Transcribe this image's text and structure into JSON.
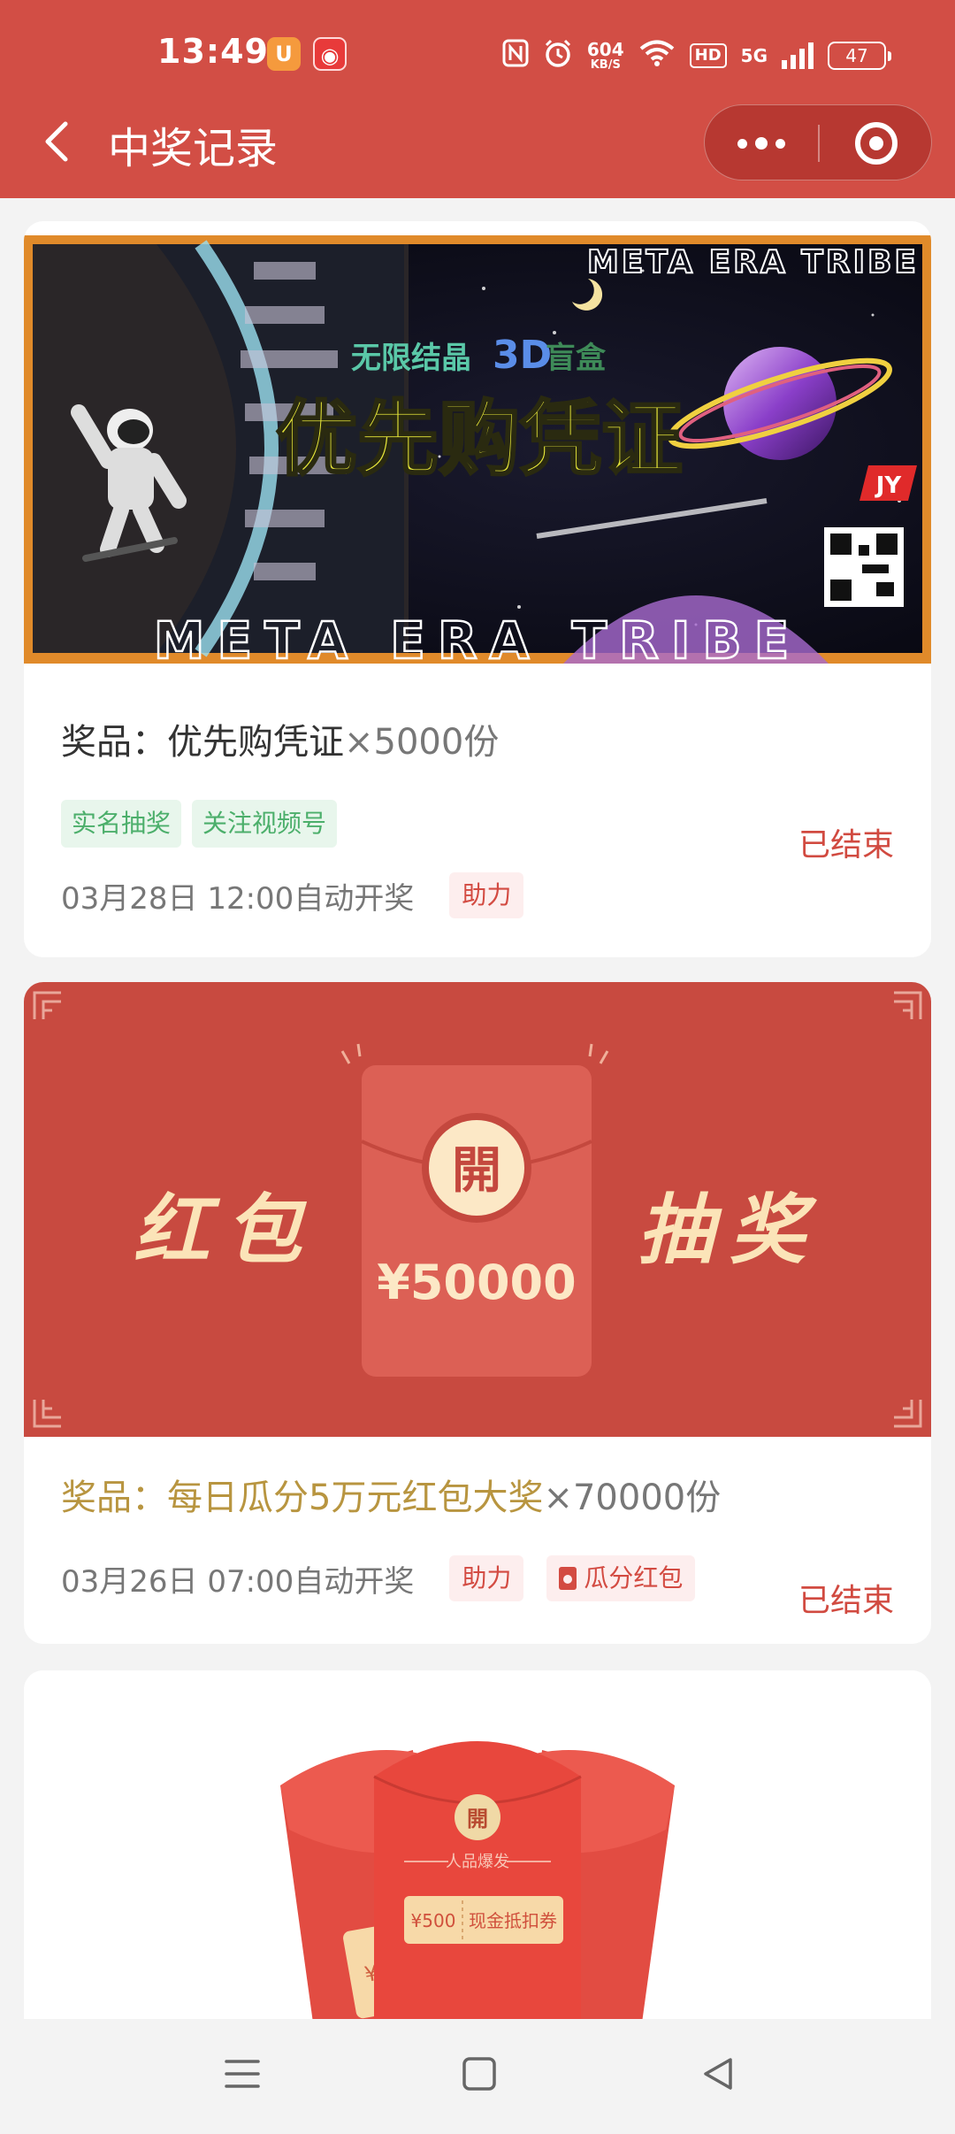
{
  "status_bar": {
    "time": "13:49",
    "net_speed_value": "604",
    "net_speed_unit": "KB/S",
    "hd": "HD",
    "network": "5G",
    "battery": "47",
    "icons": [
      "uc-browser-icon",
      "netease-music-icon",
      "nfc-icon",
      "alarm-icon",
      "wifi-icon",
      "signal-icon",
      "battery-icon"
    ]
  },
  "nav": {
    "title": "中奖记录",
    "back_icon": "chevron-left-icon",
    "more_icon": "more-dots-icon",
    "close_icon": "target-close-icon"
  },
  "colors": {
    "header_bg": "#d24e45",
    "ended": "#d14a40",
    "tag_green": "#4caf6b",
    "gold_title": "#b89540"
  },
  "cards": [
    {
      "banner": {
        "brand_top": "META ERA TRIBE",
        "subtitle_a": "无限结晶",
        "subtitle_b": "3D",
        "subtitle_c": "盲盒",
        "headline": "优先购凭证",
        "logo": "JY",
        "brand_bottom": "META ERA TRIBE"
      },
      "prize_label": "奖品：",
      "prize_name": "优先购凭证",
      "prize_qty": "×5000份",
      "tags": [
        "实名抽奖",
        "关注视频号"
      ],
      "draw_time": "03月28日 12:00自动开奖",
      "mode_tags": [
        "助力"
      ],
      "status": "已结束"
    },
    {
      "banner": {
        "left_text": "红包",
        "right_text": "抽奖",
        "seal": "開",
        "amount": "¥50000"
      },
      "prize_label": "奖品：",
      "prize_name": "每日瓜分5万元红包大奖",
      "prize_qty": "×70000份",
      "draw_time": "03月26日 07:00自动开奖",
      "mode_tags": [
        "助力",
        "瓜分红包"
      ],
      "status": "已结束"
    },
    {
      "banner": {
        "seal": "開",
        "caption": "人品爆发",
        "coupon_amount": "¥500",
        "coupon_label": "现金抵扣券",
        "side_amount": "¥"
      }
    }
  ],
  "system_nav": {
    "menu_icon": "menu-lines-icon",
    "home_icon": "square-home-icon",
    "back_icon": "triangle-back-icon"
  }
}
